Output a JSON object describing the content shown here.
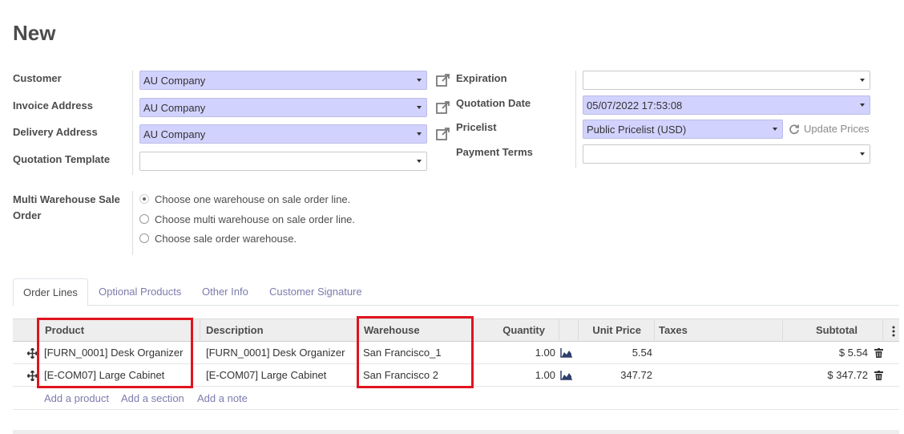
{
  "page": {
    "title": "New"
  },
  "form": {
    "customer": {
      "label": "Customer",
      "value": "AU Company"
    },
    "invoice_address": {
      "label": "Invoice Address",
      "value": "AU Company"
    },
    "delivery_address": {
      "label": "Delivery Address",
      "value": "AU Company"
    },
    "quotation_template": {
      "label": "Quotation Template",
      "value": ""
    },
    "expiration": {
      "label": "Expiration",
      "value": ""
    },
    "quotation_date": {
      "label": "Quotation Date",
      "value": "05/07/2022 17:53:08"
    },
    "pricelist": {
      "label": "Pricelist",
      "value": "Public Pricelist (USD)",
      "update_label": "Update Prices"
    },
    "payment_terms": {
      "label": "Payment Terms",
      "value": ""
    },
    "multi_warehouse": {
      "label_line1": "Multi Warehouse Sale",
      "label_line2": "Order",
      "options": [
        {
          "label": "Choose one warehouse on sale order line.",
          "selected": true
        },
        {
          "label": "Choose multi warehouse on sale order line.",
          "selected": false
        },
        {
          "label": "Choose sale order warehouse.",
          "selected": false
        }
      ]
    }
  },
  "tabs": [
    {
      "label": "Order Lines",
      "active": true
    },
    {
      "label": "Optional Products",
      "active": false
    },
    {
      "label": "Other Info",
      "active": false
    },
    {
      "label": "Customer Signature",
      "active": false
    }
  ],
  "table": {
    "headers": {
      "product": "Product",
      "description": "Description",
      "warehouse": "Warehouse",
      "quantity": "Quantity",
      "unit_price": "Unit Price",
      "taxes": "Taxes",
      "subtotal": "Subtotal"
    },
    "rows": [
      {
        "product": "[FURN_0001] Desk Organizer",
        "description": "[FURN_0001] Desk Organizer",
        "warehouse": "San Francisco_1",
        "quantity": "1.00",
        "unit_price": "5.54",
        "taxes": "",
        "subtotal": "$ 5.54"
      },
      {
        "product": "[E-COM07] Large Cabinet",
        "description": "[E-COM07] Large Cabinet",
        "warehouse": "San Francisco 2",
        "quantity": "1.00",
        "unit_price": "347.72",
        "taxes": "",
        "subtotal": "$ 347.72"
      }
    ],
    "add_links": {
      "product": "Add a product",
      "section": "Add a section",
      "note": "Add a note"
    }
  },
  "colors": {
    "required_field": "#d2d2ff",
    "link": "#7c7bad",
    "highlight_box": "#e0141e"
  }
}
